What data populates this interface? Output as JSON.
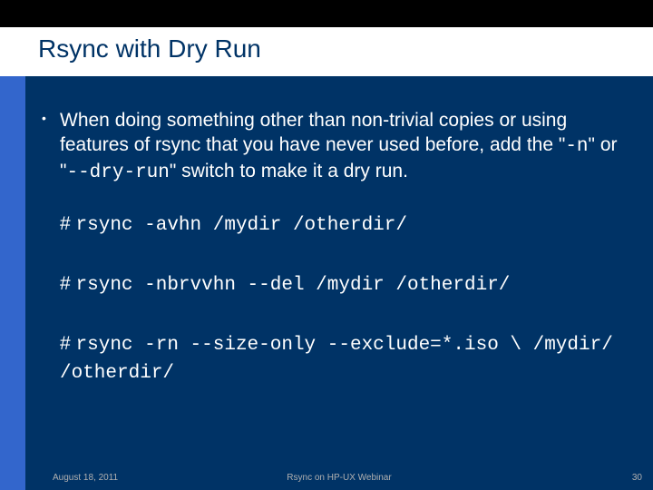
{
  "title": "Rsync with Dry Run",
  "bullet_pre": "When doing something other than non-trivial copies or using features of rsync that you have never used before, add the \"",
  "flag_n": "-n",
  "bullet_mid": "\" or \"",
  "flag_dry": "--dry-run",
  "bullet_post": "\" switch to make it a dry run.",
  "cmd1_hash": "# ",
  "cmd1_text": "rsync -avhn /mydir /otherdir/",
  "cmd2_hash": "# ",
  "cmd2_text": "rsync -nbrvvhn --del /mydir /otherdir/",
  "cmd3_hash": "# ",
  "cmd3_text": "rsync -rn --size-only --exclude=*.iso \\ /mydir/ /otherdir/",
  "footer_date": "August 18, 2011",
  "footer_title": "Rsync on HP-UX Webinar",
  "footer_page": "30"
}
